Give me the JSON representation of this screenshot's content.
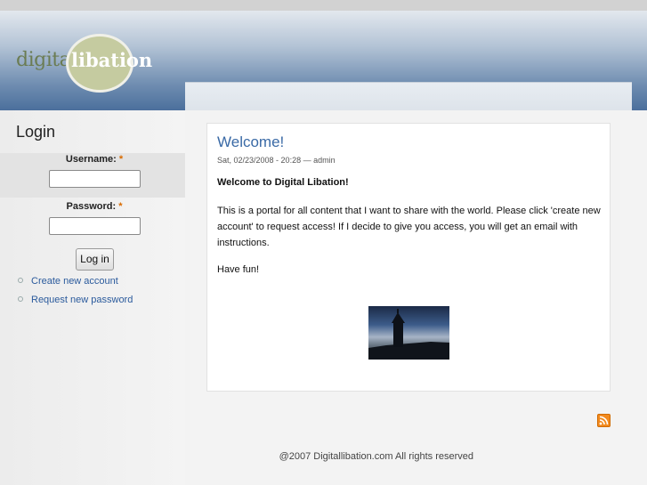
{
  "logo": {
    "word1": "digital",
    "word2": "libation"
  },
  "sidebar": {
    "title": "Login",
    "username_label": "Username:",
    "password_label": "Password:",
    "required_mark": "*",
    "username_value": "",
    "password_value": "",
    "login_button": "Log in",
    "links": [
      "Create new account",
      "Request new password"
    ]
  },
  "post": {
    "title": "Welcome!",
    "meta": "Sat, 02/23/2008 - 20:28 — admin",
    "lead": "Welcome to Digital Libation!",
    "body": "This is a portal for all content that I want to share with the world. Please click 'create new account' to request access! If I decide to give you access, you will get an email with instructions.",
    "closing": "Have fun!",
    "image_icon": "lighthouse-silhouette-image"
  },
  "footer": {
    "copyright": "@2007 Digitallibation.com All rights reserved",
    "rss_icon": "rss-icon"
  },
  "colors": {
    "link": "#2a5a9c",
    "title": "#3a6aa6",
    "required": "#d96b00",
    "rss": "#f28a1e"
  }
}
